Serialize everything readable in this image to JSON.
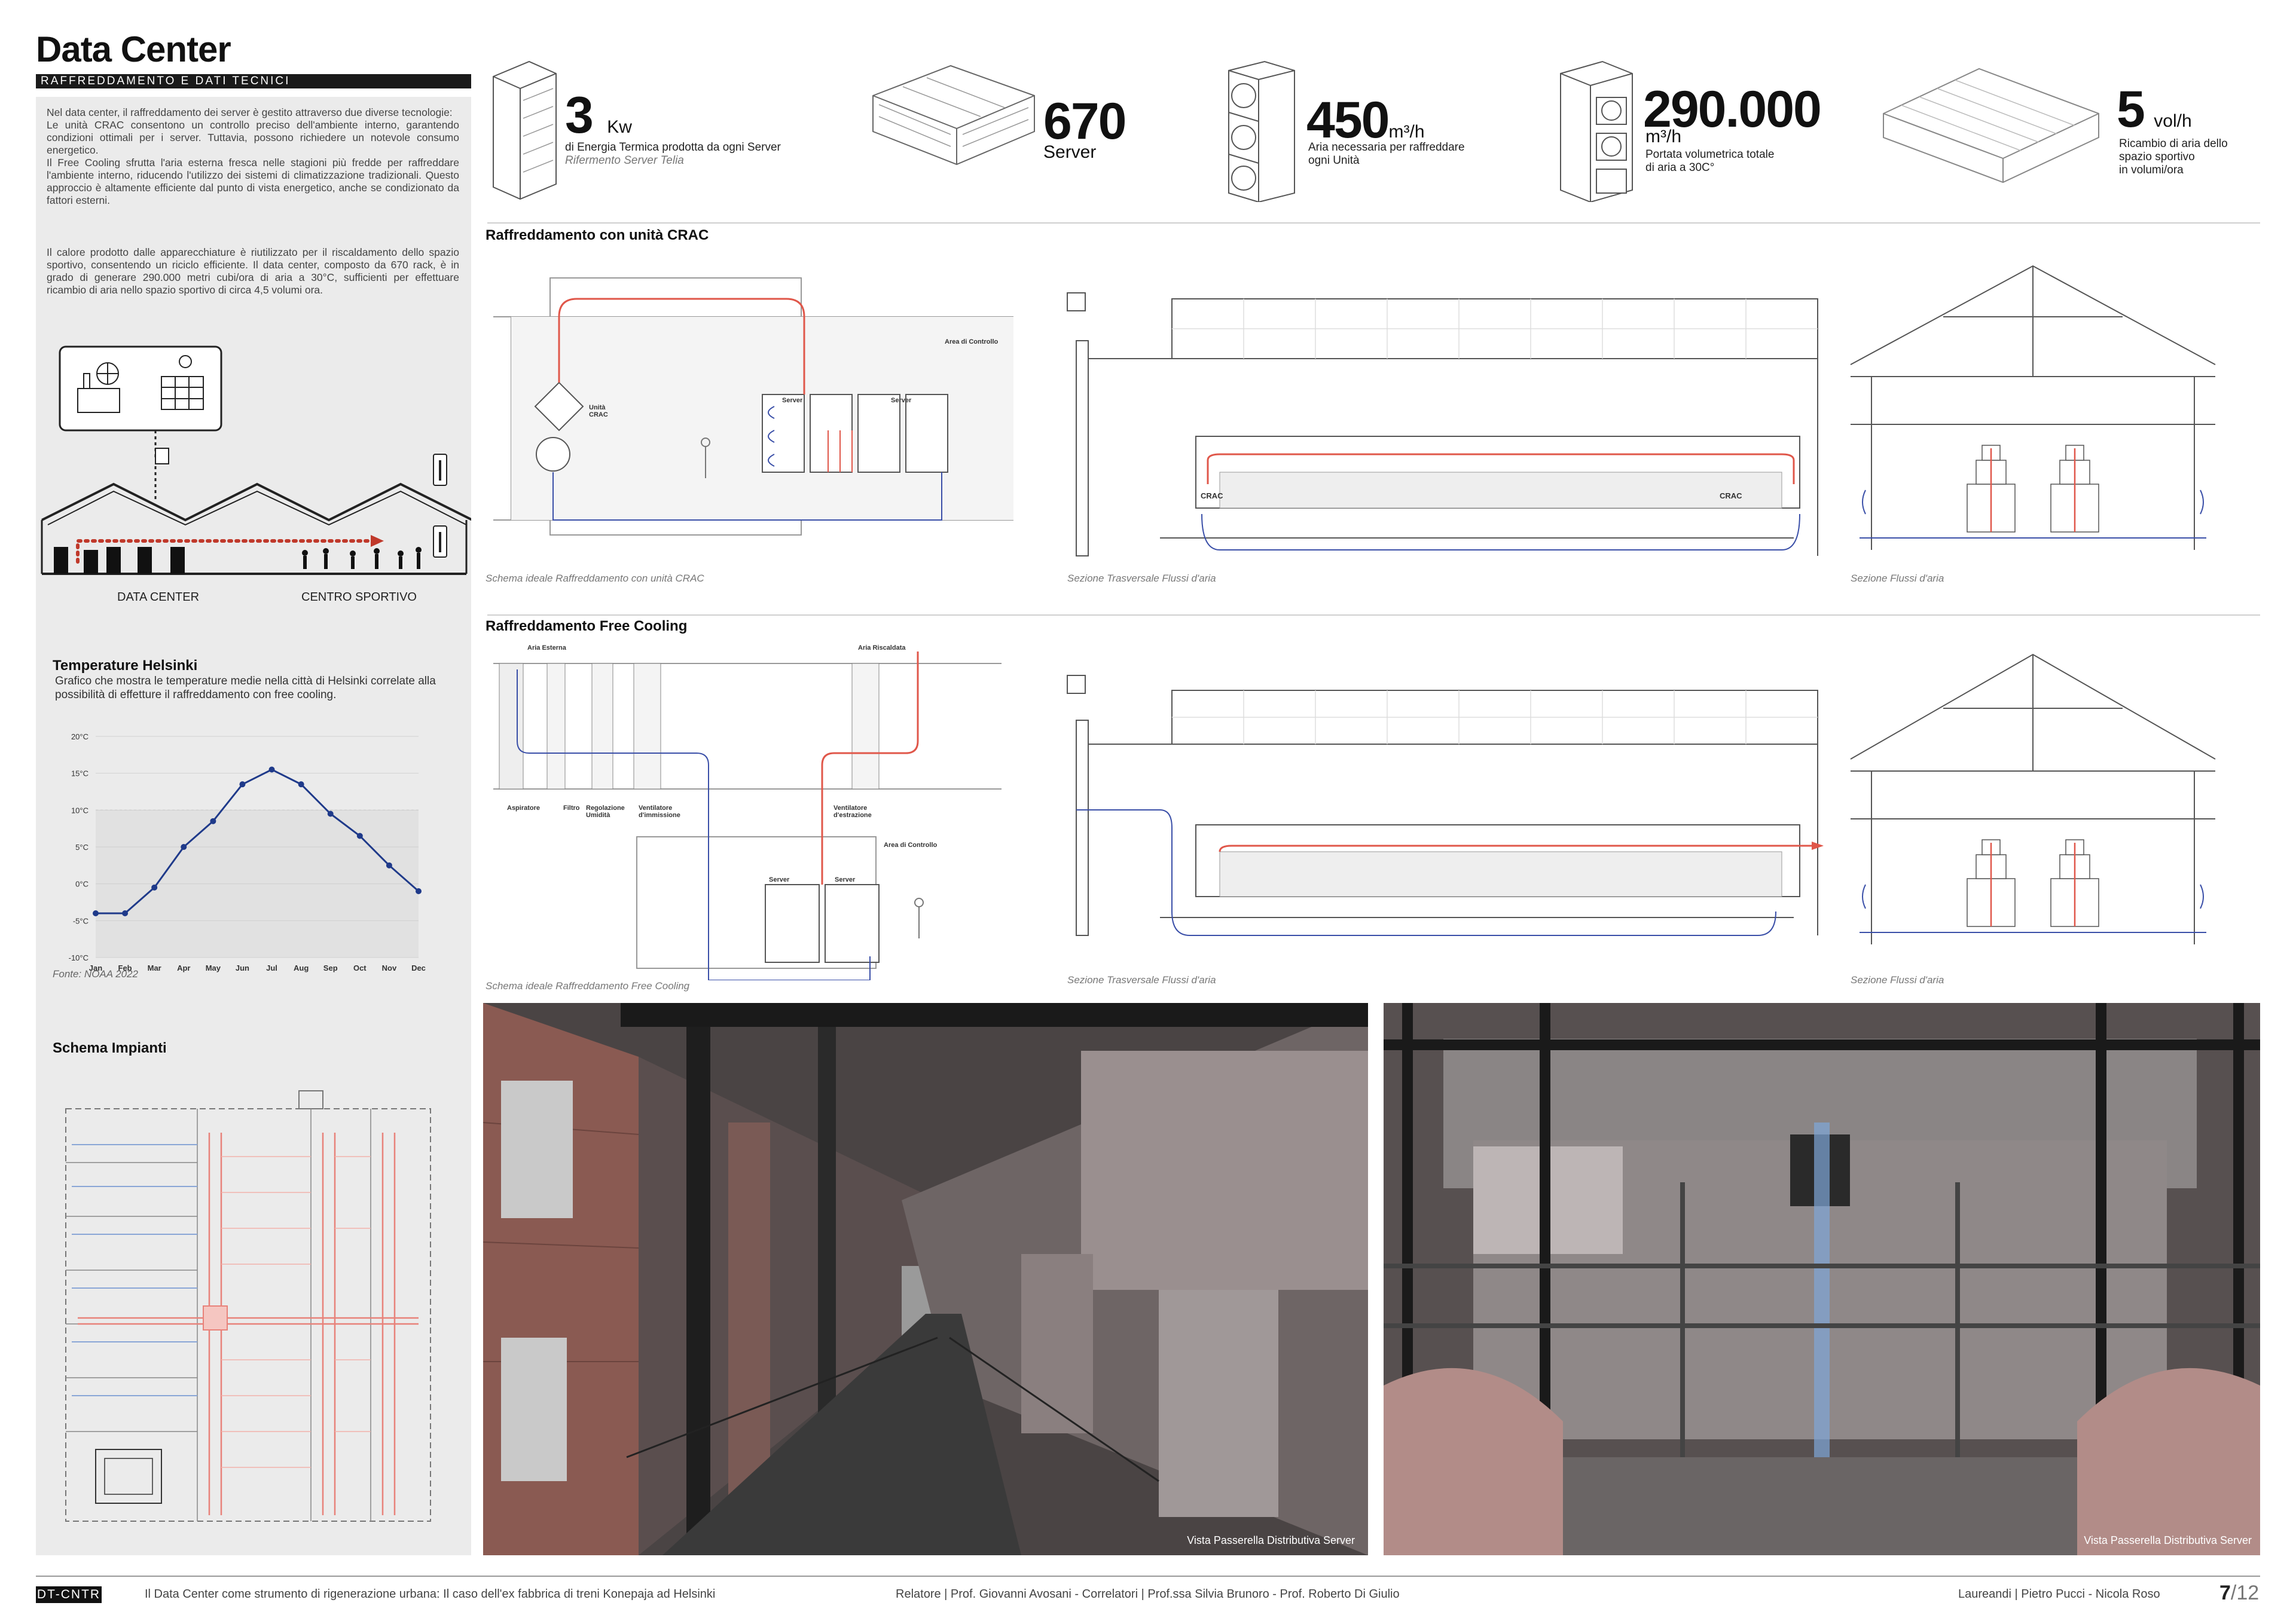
{
  "header": {
    "title": "Data Center",
    "subtitle": "RAFFREDDAMENTO E DATI TECNICI"
  },
  "intro": {
    "p1": "Nel data center, il raffreddamento dei server è gestito attraverso due diverse tecnologie:",
    "p2": "Le unità CRAC consentono un controllo preciso dell'ambiente interno, garantendo condizioni ottimali per i server. Tuttavia, possono richiedere un notevole consumo energetico.",
    "p3": "Il Free Cooling sfrutta l'aria esterna fresca nelle stagioni più fredde per raffreddare l'ambiente interno, riducendo l'utilizzo dei sistemi di climatizzazione tradizionali. Questo approccio è altamente efficiente dal punto di vista energetico, anche se condizionato da fattori esterni.",
    "p4": "Il calore prodotto dalle apparecchiature è riutilizzato per il riscaldamento dello spazio sportivo, consentendo un riciclo efficiente. Il data center, composto da 670 rack, è in grado di generare 290.000 metri cubi/ora di aria a 30°C, sufficienti per effettuare ricambio di aria nello spazio sportivo di circa 4,5 volumi ora."
  },
  "building_diagram": {
    "label_left": "DATA CENTER",
    "label_right": "CENTRO SPORTIVO"
  },
  "temperature": {
    "title": "Temperature Helsinki",
    "description": "Grafico che mostra le temperature medie nella città di Helsinki correlate alla possibilità di effetture il raffreddamento con free cooling.",
    "source": "Fonte: NOAA 2022"
  },
  "chart_data": {
    "type": "line",
    "categories": [
      "Jan",
      "Feb",
      "Mar",
      "Apr",
      "May",
      "Jun",
      "Jul",
      "Aug",
      "Sep",
      "Oct",
      "Nov",
      "Dec"
    ],
    "series": [
      {
        "values": [
          -4,
          -4,
          -0.5,
          5,
          8.5,
          13.5,
          15.5,
          13.5,
          9.5,
          6.5,
          2.5,
          -1
        ]
      }
    ],
    "y_ticks": [
      "20°C",
      "15°C",
      "10°C",
      "5°C",
      "0°C",
      "-5°C",
      "-10°C"
    ],
    "ylim": [
      -10,
      20
    ],
    "threshold": 10,
    "color": "#1f3a8a"
  },
  "impianti": {
    "title": "Schema Impianti"
  },
  "stats": [
    {
      "value": "3",
      "unit": "Kw",
      "desc1": "di Energia Termica prodotta da ogni Server",
      "desc2": "Rifermento Server Telia"
    },
    {
      "value": "670",
      "unit": "",
      "desc1": "Server",
      "desc2": ""
    },
    {
      "value": "450",
      "unit": "m³/h",
      "desc1": "Aria necessaria per raffreddare",
      "desc2": "ogni Unità"
    },
    {
      "value": "290.000",
      "unit": "m³/h",
      "desc1": "Portata volumetrica totale",
      "desc2": "di aria a 30C°"
    },
    {
      "value": "5",
      "unit": "vol/h",
      "desc1": "Ricambio di aria dello",
      "desc2": "spazio sportivo",
      "desc3": "in volumi/ora"
    }
  ],
  "crac": {
    "title": "Raffreddamento con unità CRAC",
    "cap1": "Schema ideale Raffreddamento con unità CRAC",
    "cap2": "Sezione Trasversale Flussi d'aria",
    "cap3": "Sezione Flussi d'aria",
    "lbl_area": "Area di Controllo",
    "lbl_unit": "Unità CRAC",
    "lbl_server": "Server",
    "lbl_crac": "CRAC"
  },
  "free": {
    "title": "Raffreddamento Free Cooling",
    "cap1": "Schema ideale Raffreddamento Free Cooling",
    "cap2": "Sezione Trasversale Flussi d'aria",
    "cap3": "Sezione Flussi d'aria",
    "lbl_ext": "Aria Esterna",
    "lbl_hot": "Aria Riscaldata",
    "lbl_asp": "Aspiratore",
    "lbl_filtro": "Filtro",
    "lbl_reg": "Regolazione Umidità",
    "lbl_vent_in": "Ventilatore d'immissione",
    "lbl_vent_out": "Ventilatore d'estrazione",
    "lbl_area": "Area di Controllo",
    "lbl_server": "Server"
  },
  "photos": {
    "cap_left": "Vista Passerella Distributiva Server",
    "cap_right": "Vista Passerella Distributiva Server"
  },
  "footer": {
    "badge": "DT-CNTR",
    "thesis": "Il Data Center come strumento di rigenerazione urbana: Il caso dell'ex fabbrica di treni Konepaja ad Helsinki",
    "relatore": "Relatore | Prof. Giovanni Avosani - Correlatori | Prof.ssa Silvia Brunoro - Prof. Roberto Di Giulio",
    "laureandi": "Laureandi | Pietro Pucci - Nicola Roso",
    "page": "7",
    "total": "/12"
  }
}
